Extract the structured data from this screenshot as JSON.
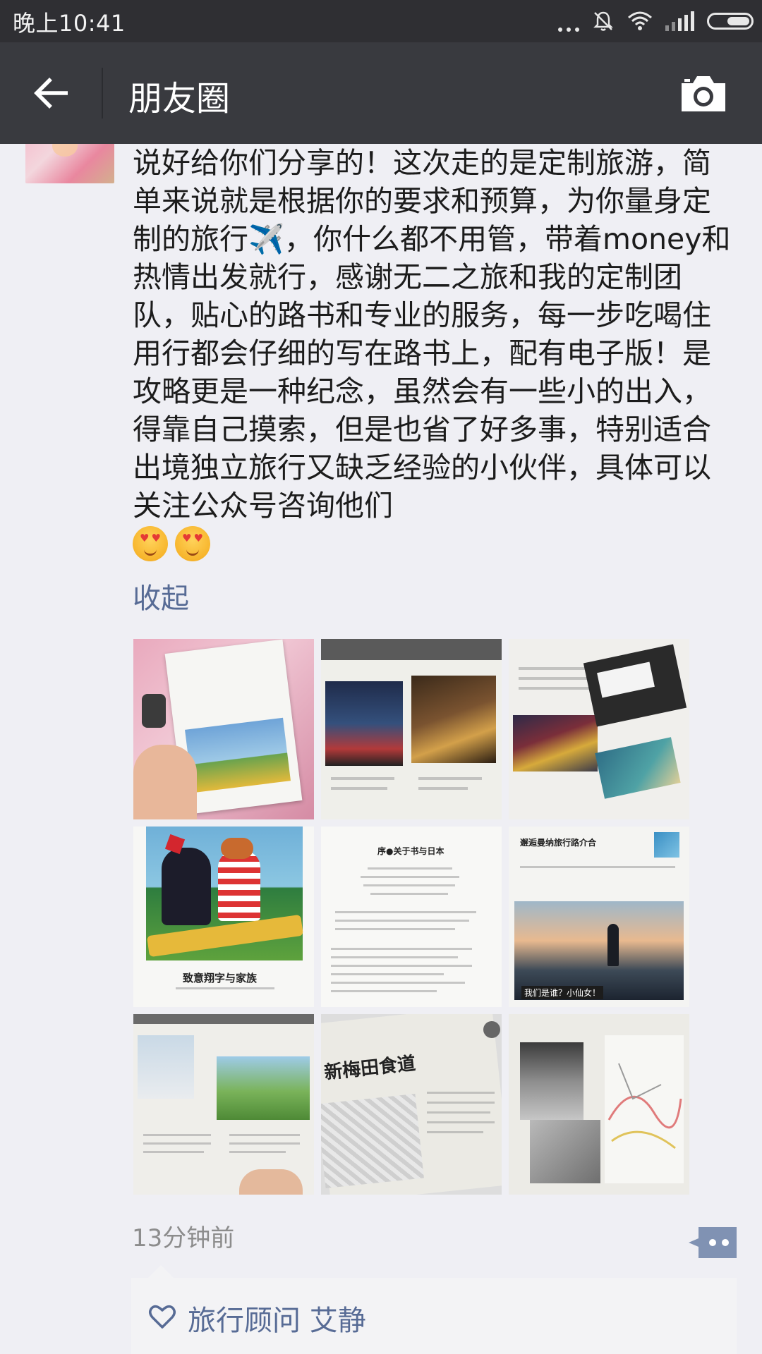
{
  "status_bar": {
    "time": "晚上10:41"
  },
  "nav": {
    "title": "朋友圈",
    "back_icon": "arrow-left-icon",
    "camera_icon": "camera-icon"
  },
  "post": {
    "text": "说好给你们分享的！这次走的是定制旅游，简单来说就是根据你的要求和预算，为你量身定制的旅行✈️，你什么都不用管，带着money和热情出发就行，感谢无二之旅和我的定制团队，贴心的路书和专业的服务，每一步吃喝住用行都会仔细的写在路书上，配有电子版！是攻略更是一种纪念，虽然会有一些小的出入，得靠自己摸索，但是也省了好多事，特别适合出境独立旅行又缺乏经验的小伙伴，具体可以关注公众号咨询他们",
    "emojis": [
      "heart-eyes-emoji",
      "heart-eyes-emoji"
    ],
    "collapse_label": "收起",
    "images": [
      {
        "kind": "guidebook-cover"
      },
      {
        "kind": "guidebook-spread-city"
      },
      {
        "kind": "guidebook-spread-map"
      },
      {
        "kind": "cartoon-illustration",
        "caption": "致意翔字与家族"
      },
      {
        "kind": "intro-page",
        "caption": "序●关于书与日本"
      },
      {
        "kind": "team-page",
        "caption": "邂逅曼纳旅行路介合",
        "photo_caption": "我们是谁？小仙女！"
      },
      {
        "kind": "guidebook-spread-nature"
      },
      {
        "kind": "guidebook-spread-food",
        "caption": "新梅田食道"
      },
      {
        "kind": "guidebook-spread-map2"
      }
    ],
    "timestamp": "13分钟前",
    "likes": {
      "names": "旅行顾问 艾静",
      "icon": "heart-outline-icon"
    }
  }
}
